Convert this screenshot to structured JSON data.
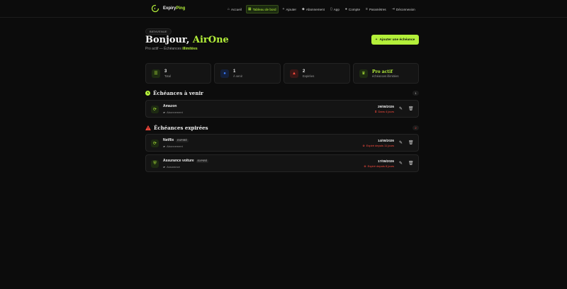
{
  "brand": {
    "name_prefix": "Expiry",
    "name_suffix": "Ping"
  },
  "nav": [
    {
      "label": "Accueil",
      "icon": "home-icon",
      "glyph": "⌂"
    },
    {
      "label": "Tableau de bord",
      "icon": "dashboard-icon",
      "glyph": "▦",
      "active": true
    },
    {
      "label": "Ajouter",
      "icon": "plus-icon",
      "glyph": "+"
    },
    {
      "label": "Abonnement",
      "icon": "diamond-icon",
      "glyph": "◆"
    },
    {
      "label": "App",
      "icon": "phone-icon",
      "glyph": "▯"
    },
    {
      "label": "Compte",
      "icon": "user-icon",
      "glyph": "●"
    },
    {
      "label": "Paramètres",
      "icon": "settings-icon",
      "glyph": "≡"
    },
    {
      "label": "Déconnexion",
      "icon": "logout-icon",
      "glyph": "⇥"
    }
  ],
  "header": {
    "badge": "BIENVENUE",
    "greeting": "Bonjour,",
    "user_name": "AirOne",
    "plan_text": "Pro actif — Échéances",
    "plan_highlight": "illimitées",
    "add_button": "Ajouter une échéance"
  },
  "stats": [
    {
      "value": "3",
      "label": "Total",
      "icon": "list-icon",
      "glyph": "☰",
      "color": "#b4f03a",
      "bg": "#1e2c12"
    },
    {
      "value": "1",
      "label": "À venir",
      "icon": "clock-icon",
      "glyph": "●",
      "color": "#3c7cff",
      "bg": "#14203a"
    },
    {
      "value": "2",
      "label": "Expirées",
      "icon": "warning-icon",
      "glyph": "▲",
      "color": "#ff4b3e",
      "bg": "#3a1716"
    },
    {
      "value": "Pro actif",
      "label": "échéances illimitées",
      "icon": "crown-icon",
      "glyph": "♛",
      "color": "#b4f03a",
      "bg": "#1e2c12"
    }
  ],
  "sections": {
    "upcoming": {
      "title": "Échéances à venir",
      "count": "1",
      "icon": "clock-icon"
    },
    "expired": {
      "title": "Échéances expirées",
      "count": "2",
      "icon": "warning-icon"
    }
  },
  "upcoming_items": [
    {
      "name": "Amazon",
      "tag": "",
      "category": "Abonnement",
      "date": "29/08/2026",
      "status": "Dans 4 jours",
      "icon": "refresh-icon"
    }
  ],
  "expired_items": [
    {
      "name": "Netflix",
      "tag": "EXPIRÉ",
      "category": "Abonnement",
      "date": "14/08/2026",
      "status": "Expiré depuis 11 jours",
      "icon": "refresh-icon"
    },
    {
      "name": "Assurance voiture",
      "tag": "EXPIRÉ",
      "category": "Assurance",
      "date": "17/08/2026",
      "status": "Expiré depuis 8 jours",
      "icon": "shield-icon"
    }
  ],
  "colors": {
    "accent": "#b4f03a",
    "danger": "#ff4b3e",
    "info": "#3c7cff",
    "background": "#0c0c0c"
  }
}
